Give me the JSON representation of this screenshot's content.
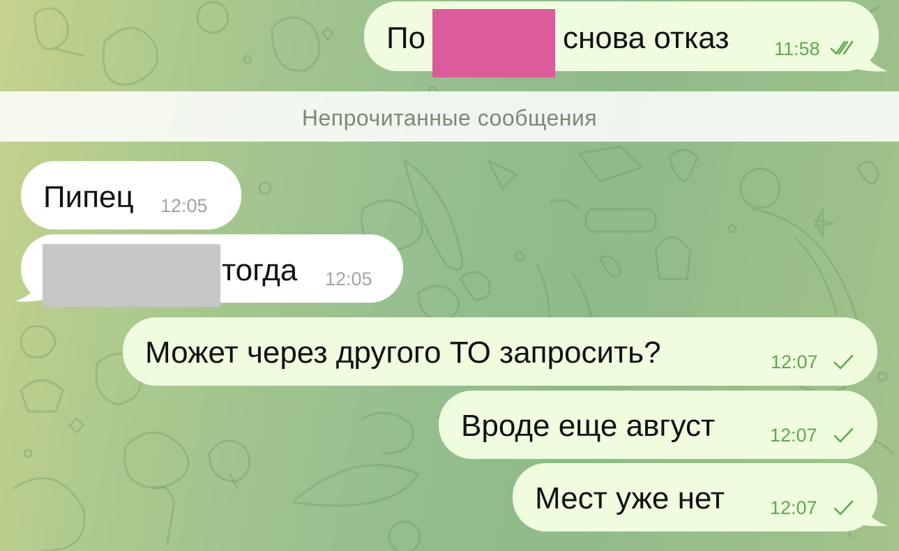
{
  "app": "Telegram",
  "colors": {
    "outgoing_bubble": "#effdde",
    "incoming_bubble": "#ffffff",
    "outgoing_time": "#5fa74f",
    "incoming_time": "#a4a4a4",
    "redaction_pink": "#db5b9b",
    "redaction_gray": "#c6c6c6"
  },
  "divider": {
    "label": "Непрочитанные сообщения"
  },
  "messages": [
    {
      "direction": "outgoing",
      "text_before": "По",
      "redacted": true,
      "redaction_color": "pink",
      "text": "снова отказ",
      "time": "11:58",
      "status": "read",
      "status_icon": "double-check-icon"
    },
    {
      "direction": "incoming",
      "text": "Пипец",
      "time": "12:05"
    },
    {
      "direction": "incoming",
      "redacted": true,
      "redaction_color": "gray",
      "text": "тогда",
      "time": "12:05"
    },
    {
      "direction": "outgoing",
      "text": "Может через другого ТО запросить?",
      "time": "12:07",
      "status": "sent",
      "status_icon": "check-icon"
    },
    {
      "direction": "outgoing",
      "text": "Вроде еще август",
      "time": "12:07",
      "status": "sent",
      "status_icon": "check-icon"
    },
    {
      "direction": "outgoing",
      "text": "Мест уже нет",
      "time": "12:07",
      "status": "sent",
      "status_icon": "check-icon"
    }
  ]
}
